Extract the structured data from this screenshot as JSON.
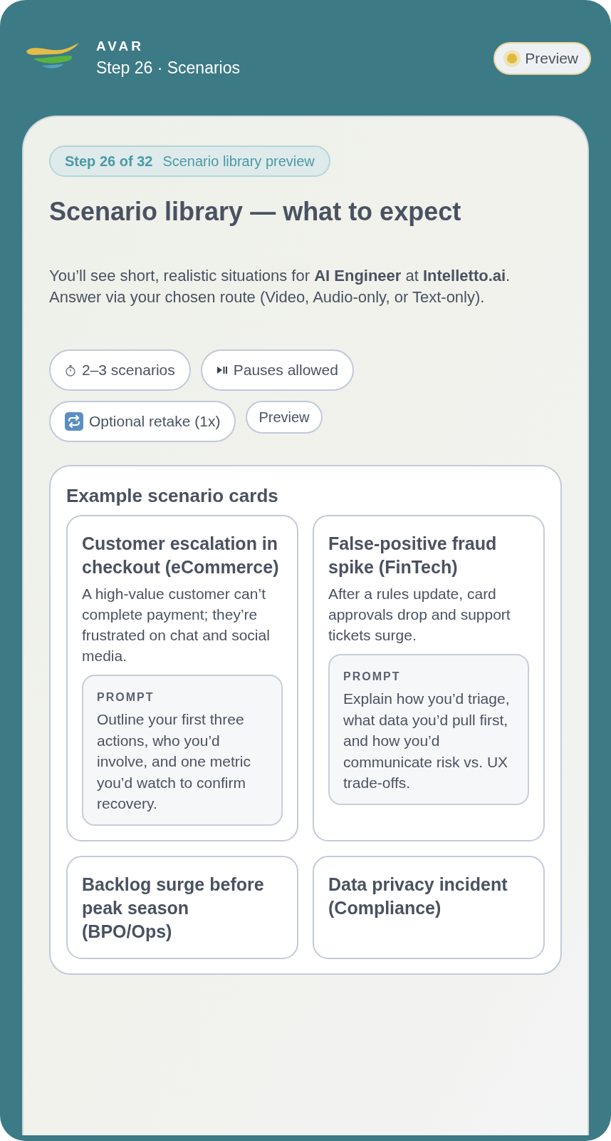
{
  "header": {
    "brand": "AVAR",
    "subtitle": "Step 26 · Scenarios",
    "status": "Preview"
  },
  "badge": {
    "step": "Step 26 of 32",
    "label": "Scenario library preview"
  },
  "title": "Scenario library — what to expect",
  "intro": "You’ll see short, realistic situations for **AI Engineer** at **Intelletto.ai**. Answer via your chosen route (Video, Audio-only, or Text-only).",
  "chips": [
    {
      "kind": "timer",
      "label": "2–3 scenarios"
    },
    {
      "kind": "play-pause",
      "label": "Pauses allowed"
    },
    {
      "kind": "repeat",
      "label": "Optional retake (1x)"
    },
    {
      "kind": "plain",
      "label": "Preview"
    }
  ],
  "examples": {
    "heading": "Example scenario cards",
    "cards": [
      {
        "title": "Customer escalation in checkout (eCommerce)",
        "body": "A high-value customer can’t complete payment; they’re frustrated on chat and social media.",
        "prompt_label": "PROMPT",
        "prompt": "Outline your first three actions, who you’d involve, and one metric you’d watch to confirm recovery."
      },
      {
        "title": "False-positive fraud spike (FinTech)",
        "body": "After a rules update, card approvals drop and support tickets surge.",
        "prompt_label": "PROMPT",
        "prompt": "Explain how you’d triage, what data you’d pull first, and how you’d communicate risk vs. UX trade-offs."
      },
      {
        "title": "Backlog surge before peak season (BPO/Ops)"
      },
      {
        "title": "Data privacy incident (Compliance)"
      }
    ]
  }
}
